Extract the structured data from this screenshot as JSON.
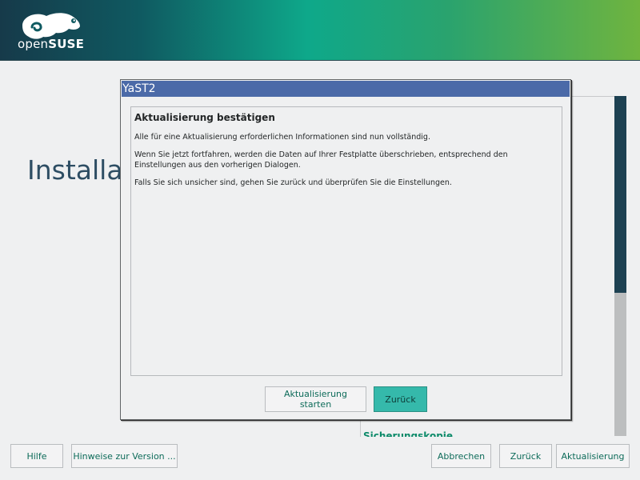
{
  "branding": {
    "logo_text_prefix": "open",
    "logo_text_brand": "SUSE"
  },
  "background": {
    "title": "Installat",
    "partial_link": "Sicherungskopie",
    "scrollbar_position": 0.58
  },
  "footer": {
    "help_label": "Hilfe",
    "release_notes_label": "Hinweise zur Version ...",
    "abort_label": "Abbrechen",
    "back_label": "Zurück",
    "next_label": "Aktualisierung"
  },
  "dialog": {
    "title": "YaST2",
    "heading": "Aktualisierung bestätigen",
    "paragraphs": [
      "Alle für eine Aktualisierung erforderlichen Informationen sind nun vollständig.",
      "Wenn Sie jetzt fortfahren, werden die Daten auf Ihrer Festplatte überschrieben, entsprechend den Einstellungen aus den vorherigen Dialogen.",
      "Falls Sie sich unsicher sind, gehen Sie zurück und überprüfen Sie die Einstellungen."
    ],
    "start_button_label": "Aktualisierung starten",
    "back_button_label": "Zurück"
  },
  "colors": {
    "accent": "#35b9ab",
    "title_bar": "#4b6aa8",
    "link": "#0d6b59"
  }
}
